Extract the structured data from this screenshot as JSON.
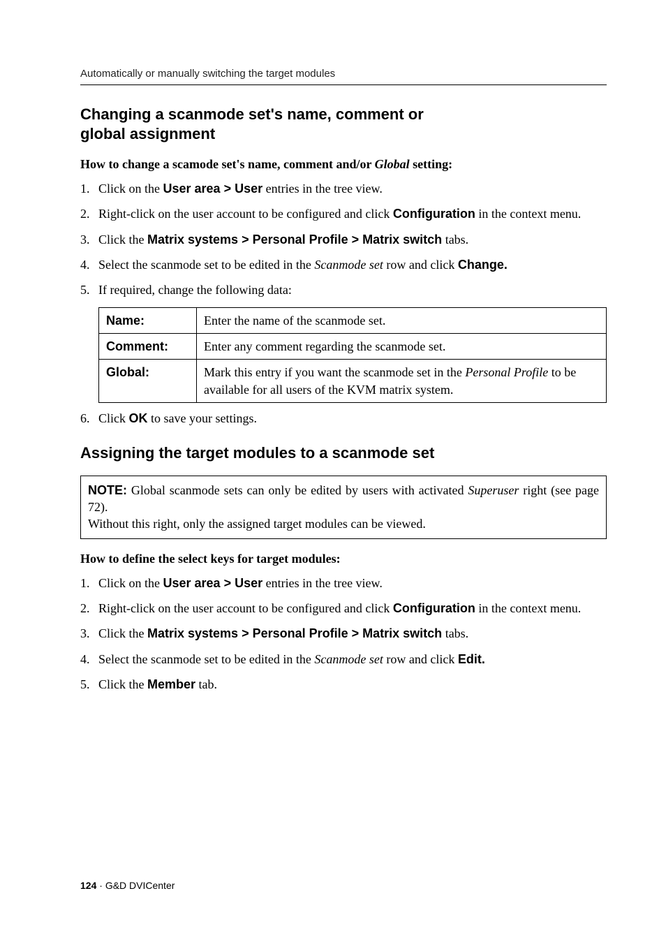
{
  "header": "Automatically or manually switching the target modules",
  "section1_title_line1": "Changing a scanmode set's name, comment or",
  "section1_title_line2": "global assignment",
  "howto1_prefix": "How to change a scamode set's name, comment and/or ",
  "howto1_global": "Global",
  "howto1_suffix": " setting:",
  "list1": {
    "i1_a": "Click on the ",
    "i1_b": "User area > User",
    "i1_c": " entries in the tree view.",
    "i2_a": "Right-click on the user account to be configured and click ",
    "i2_b": "Configuration",
    "i2_c": " in the context menu.",
    "i3_a": "Click the ",
    "i3_b": "Matrix systems > Personal Profile > Matrix switch",
    "i3_c": " tabs.",
    "i4_a": "Select the scanmode set to be edited in the ",
    "i4_b": "Scanmode set",
    "i4_c": " row and click ",
    "i4_d": "Change.",
    "i5": "If required, change the following data:"
  },
  "table": {
    "r1_label": "Name:",
    "r1_val": "Enter the name of the scanmode set.",
    "r2_label": "Comment:",
    "r2_val": "Enter any comment regarding the scanmode set.",
    "r3_label": "Global:",
    "r3_a": "Mark this entry if you want the scanmode set in the ",
    "r3_b": "Personal Profile",
    "r3_c": " to be available for all users of the KVM matrix system."
  },
  "list1_i6_a": "Click ",
  "list1_i6_b": "OK",
  "list1_i6_c": " to save your settings.",
  "section2_title": "Assigning the target modules to a scanmode set",
  "note_label": "NOTE:",
  "note_a": " Global scanmode sets can only be edited by users with activated ",
  "note_b": "Superuser",
  "note_c": " right (see page 72).",
  "note_line2": "Without this right, only the assigned target modules can be viewed.",
  "howto2": "How to define the select keys for target modules:",
  "list2": {
    "i1_a": "Click on the ",
    "i1_b": "User area > User",
    "i1_c": " entries in the tree view.",
    "i2_a": "Right-click on the user account to be configured and click ",
    "i2_b": "Configuration",
    "i2_c": " in the context menu.",
    "i3_a": "Click the ",
    "i3_b": "Matrix systems > Personal Profile > Matrix switch",
    "i3_c": " tabs.",
    "i4_a": "Select the scanmode set to be edited in the ",
    "i4_b": "Scanmode set",
    "i4_c": " row and click ",
    "i4_d": "Edit.",
    "i5_a": "Click the ",
    "i5_b": "Member",
    "i5_c": " tab."
  },
  "footer_page": "124",
  "footer_sep": " · ",
  "footer_product": "G&D DVICenter"
}
